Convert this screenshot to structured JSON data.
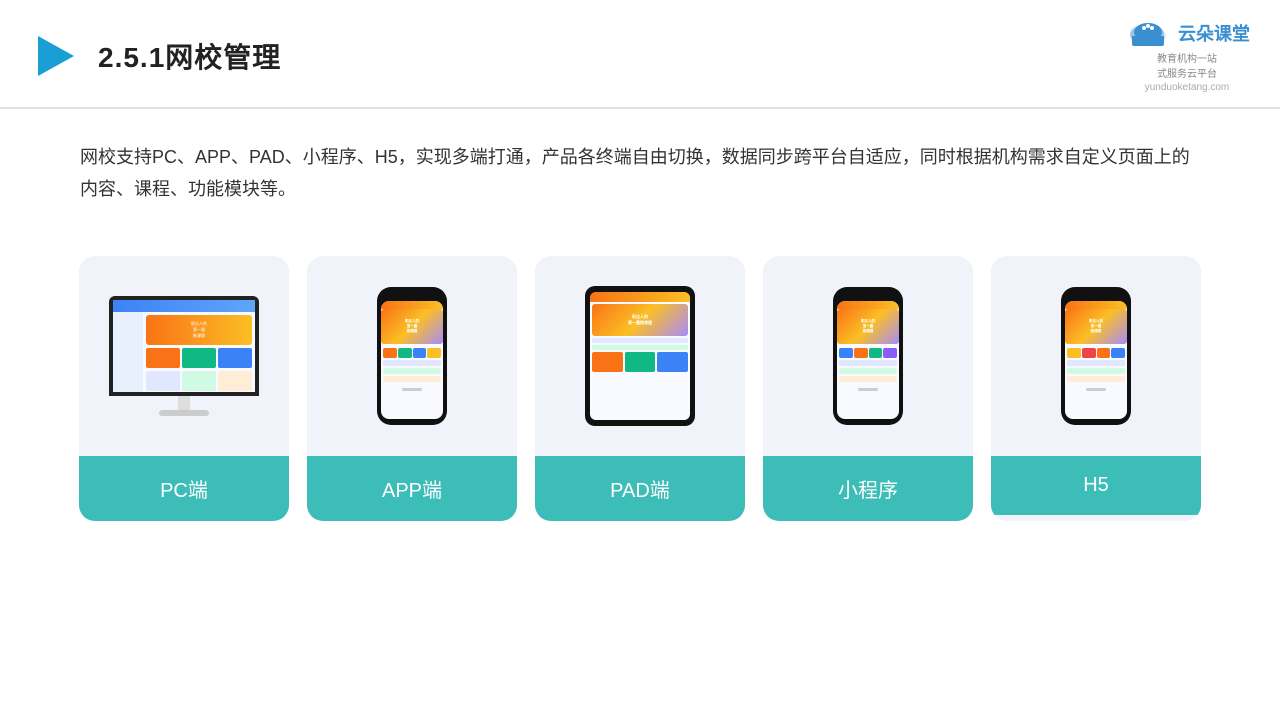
{
  "header": {
    "title": "2.5.1网校管理",
    "brand_name": "云朵课堂",
    "brand_url": "yunduoketang.com",
    "brand_slogan_line1": "教育机构一站",
    "brand_slogan_line2": "式服务云平台"
  },
  "description": {
    "text": "网校支持PC、APP、PAD、小程序、H5，实现多端打通，产品各终端自由切换，数据同步跨平台自适应，同时根据机构需求自定义页面上的内容、课程、功能模块等。"
  },
  "cards": [
    {
      "id": "pc",
      "label": "PC端",
      "type": "monitor"
    },
    {
      "id": "app",
      "label": "APP端",
      "type": "phone"
    },
    {
      "id": "pad",
      "label": "PAD端",
      "type": "tablet"
    },
    {
      "id": "mini-program",
      "label": "小程序",
      "type": "phone"
    },
    {
      "id": "h5",
      "label": "H5",
      "type": "phone"
    }
  ]
}
